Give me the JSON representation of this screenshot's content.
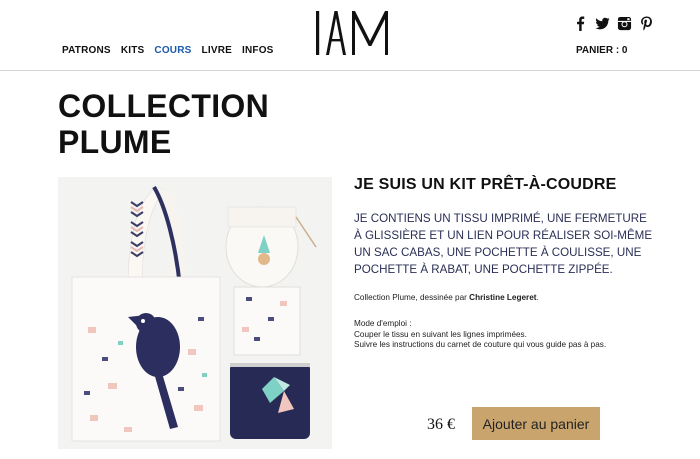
{
  "nav": {
    "items": [
      {
        "label": "PATRONS"
      },
      {
        "label": "KITS"
      },
      {
        "label": "COURS",
        "active": true
      },
      {
        "label": "LIVRE"
      },
      {
        "label": "INFOS"
      }
    ],
    "active_color": "#1a5aa8"
  },
  "logo": {
    "text": "IAM"
  },
  "social": [
    "facebook-icon",
    "twitter-icon",
    "instagram-icon",
    "pinterest-icon"
  ],
  "cart": {
    "label": "PANIER : 0"
  },
  "page": {
    "title_line1": "COLLECTION",
    "title_line2": "PLUME"
  },
  "product": {
    "heading": "JE SUIS UN KIT PRÊT-À-COUDRE",
    "description": "JE CONTIENS UN TISSU IMPRIMÉ, UNE FERMETURE À GLISSIÈRE ET UN LIEN POUR RÉALISER SOI-MÊME UN SAC CABAS, UNE POCHETTE À COULISSE, UNE POCHETTE À RABAT, UNE POCHETTE ZIPPÉE.",
    "credit_prefix": "Collection Plume, dessinée par",
    "designer": "Christine Legeret",
    "credit_suffix": ".",
    "mode_title": "Mode d'emploi :",
    "mode_line1": "Couper le tissu en suivant les lignes imprimées.",
    "mode_line2": "Suivre les instructions du carnet de couture qui vous guide pas à pas.",
    "price": "36 €",
    "add_button": "Ajouter au panier",
    "button_color": "#c9a56d"
  }
}
